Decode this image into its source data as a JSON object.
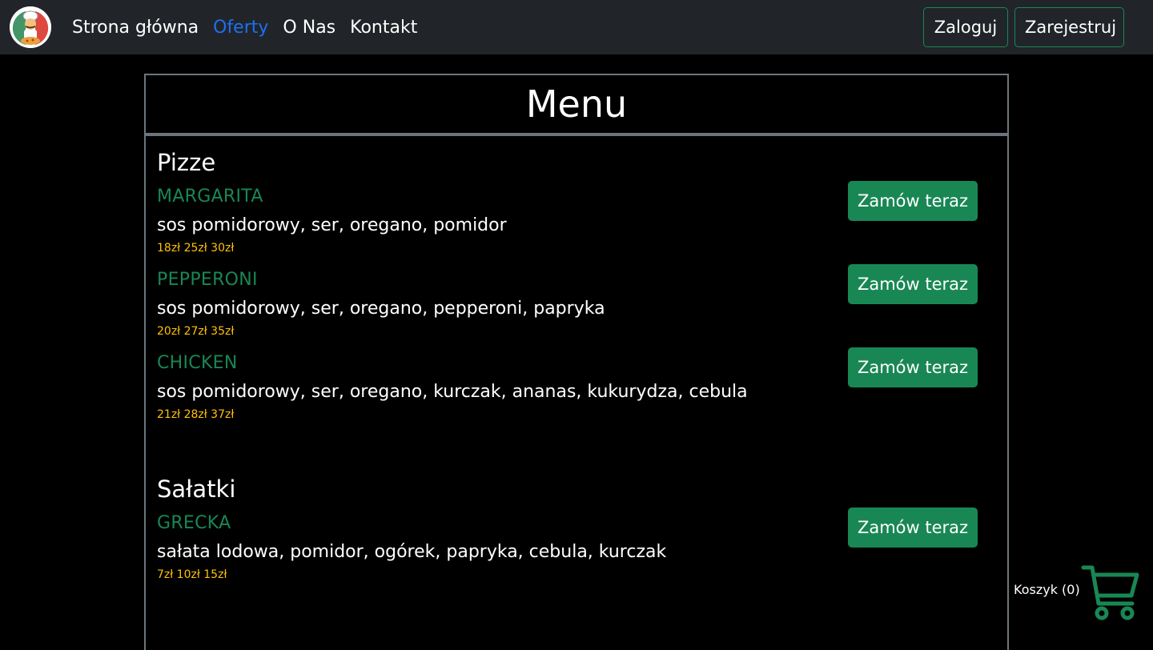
{
  "navbar": {
    "logo_icon": "chef-pizza-logo",
    "links": [
      {
        "label": "Strona główna",
        "active": false
      },
      {
        "label": "Oferty",
        "active": true
      },
      {
        "label": "O Nas",
        "active": false
      },
      {
        "label": "Kontakt",
        "active": false
      }
    ],
    "login_label": "Zaloguj",
    "register_label": "Zarejestruj"
  },
  "menu": {
    "title": "Menu",
    "sections": [
      {
        "title": "Pizze",
        "items": [
          {
            "name": "MARGARITA",
            "desc": "sos pomidorowy, ser, oregano, pomidor",
            "prices": "18zł 25zł 30zł",
            "button": "Zamów teraz"
          },
          {
            "name": "PEPPERONI",
            "desc": "sos pomidorowy, ser, oregano, pepperoni, papryka",
            "prices": "20zł 27zł 35zł",
            "button": "Zamów teraz"
          },
          {
            "name": "CHICKEN",
            "desc": "sos pomidorowy, ser, oregano, kurczak, ananas, kukurydza, cebula",
            "prices": "21zł 28zł 37zł",
            "button": "Zamów teraz"
          }
        ]
      },
      {
        "title": "Sałatki",
        "items": [
          {
            "name": "GRECKA",
            "desc": "sałata lodowa, pomidor, ogórek, papryka, cebula, kurczak",
            "prices": "7zł 10zł 15zł",
            "button": "Zamów teraz"
          }
        ]
      }
    ]
  },
  "cart": {
    "label": "Koszyk (0)",
    "icon": "shopping-cart-icon",
    "color": "#198754"
  },
  "colors": {
    "navbar_bg": "#212529",
    "active_link": "#1e6ff1",
    "accent_green": "#198754",
    "price_yellow": "#ffc107",
    "border_gray": "#6c757d"
  }
}
